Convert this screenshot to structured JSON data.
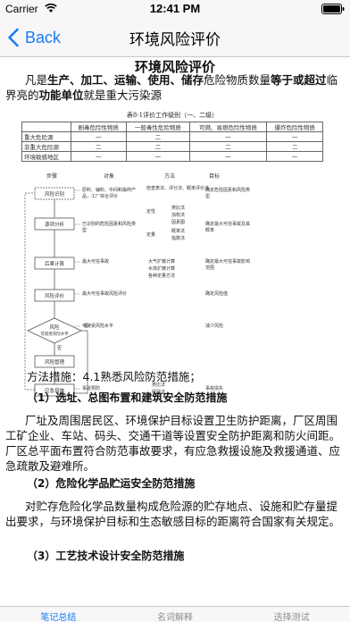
{
  "status_bar": {
    "carrier": "Carrier",
    "time": "12:41 PM"
  },
  "nav": {
    "back_label": "Back",
    "title": "环境风险评价"
  },
  "article": {
    "title": "环境风险评价",
    "intro_segments": [
      {
        "text": "凡是",
        "bold": false
      },
      {
        "text": "生产、加工、运输、使用、储存",
        "bold": true
      },
      {
        "text": "危险物质数量",
        "bold": false
      },
      {
        "text": "等于或超过",
        "bold": true
      },
      {
        "text": "临界亮的",
        "bold": false
      },
      {
        "text": "功能单位",
        "bold": true
      },
      {
        "text": "就是重大污染源",
        "bold": false
      }
    ],
    "table": {
      "caption": "表8-1评价工作级别（一、二级）",
      "headers": [
        "",
        "剧毒危险性物质",
        "一般毒性危险物质",
        "可燃、易燃危险性物质",
        "爆炸危险性物质"
      ],
      "rows": [
        [
          "重大危险源",
          "一",
          "二",
          "一",
          "一"
        ],
        [
          "非重大危险源",
          "二",
          "二",
          "二",
          "二"
        ],
        [
          "环境敏感地区",
          "一",
          "一",
          "一",
          "一"
        ]
      ]
    },
    "flowchart": {
      "col_headers": [
        "步骤",
        "对象",
        "方法",
        "目标"
      ],
      "steps": [
        "风险识别",
        "源项分析",
        "后果计算",
        "风险评价",
        "风险",
        "风险管理",
        "应急措施"
      ],
      "decision_labels": [
        "可接受风险水平",
        "否",
        "是"
      ],
      "objects": [
        "原料、辅料、中间和最终产品，工厂综合评价",
        "已识别的危险因素和风险类型",
        "最大可信事故",
        "最大可信事故风险评价",
        "可接受风险水平",
        "事故预防"
      ],
      "methods": [
        "检查表法、评分法、概率评价法",
        "定性",
        "类比法",
        "加权法",
        "因素图",
        "定量",
        "概率法",
        "指数法",
        "大气扩散计算",
        "水体扩散计算",
        "各种定量方法",
        "类比法",
        "经验法"
      ],
      "targets": [
        "确定危险因素和风险类型",
        "确定最大可信事故及其概率",
        "确定最大可信事故影响范围",
        "确定风险值",
        "减少风险",
        "事故损失"
      ]
    },
    "method_line": "方法措施：4.1熟悉风险防范措施；",
    "sections": [
      {
        "heading": "（1）选址、总图布置和建筑安全防范措施",
        "body": "厂址及周围居民区、环境保护目标设置卫生防护距离，厂区周围工矿企业、车站、码头、交通干道等设置安全防护距离和防火间距。厂区总平面布置符合防范事故要求，有应急救援设施及救援通道、应急疏散及避难所。"
      },
      {
        "heading": "（2）危险化学品贮运安全防范措施",
        "body": "对贮存危险化学品数量构成危险源的贮存地点、设施和贮存量提出要求，与环境保护目标和生态敏感目标的距离符合国家有关规定。"
      },
      {
        "heading": "（3）工艺技术设计安全防范措施",
        "body": ""
      }
    ]
  },
  "tabs": [
    {
      "label": "笔记总结",
      "active": true
    },
    {
      "label": "名词解释",
      "active": false
    },
    {
      "label": "选择测试",
      "active": false
    }
  ],
  "colors": {
    "accent": "#1a7cf5",
    "bar_bg": "#f7f7f7",
    "inactive_tab": "#8e8e93"
  }
}
